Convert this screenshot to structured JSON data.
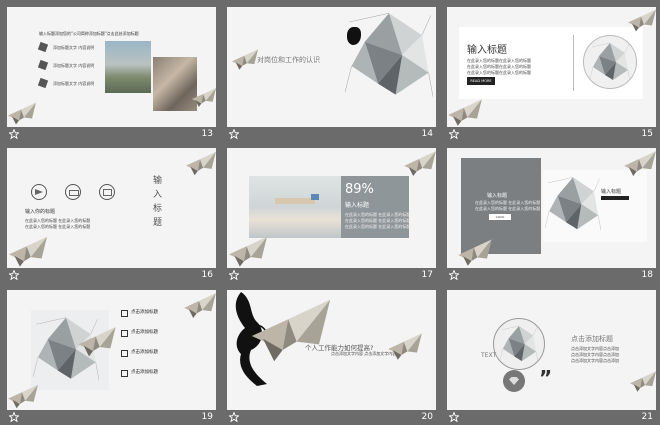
{
  "slides": [
    {
      "num": "13",
      "title": "输入标题添加您的\"公司简称添加标题\"点击此处添加标题",
      "items": [
        "添加标题文字 内容说明",
        "添加标题文字 内容说明",
        "添加标题文字 内容说明"
      ]
    },
    {
      "num": "14",
      "title": "对岗位和工作的认识"
    },
    {
      "num": "15",
      "title": "输入标题",
      "lines": [
        "在此录入您的标题在此录入您的标题",
        "在此录入您的标题在此录入您的标题",
        "在此录入您的标题在此录入您的标题"
      ],
      "button": "READ MORE"
    },
    {
      "num": "16",
      "title_vertical": "输入标题",
      "sub": "输入你的标题",
      "desc": [
        "在此录入您的标题 在此录入您的标题",
        "在此录入您的标题 在此录入您的标题"
      ]
    },
    {
      "num": "17",
      "big": "89%",
      "title": "输入标题",
      "desc": [
        "在此录入您的标题 在此录入您的标题",
        "在此录入您的标题 在此录入您的标题",
        "在此录入您的标题 在此录入您的标题"
      ]
    },
    {
      "num": "18",
      "title": "输入标题",
      "desc": [
        "在此录入您的标题 在此录入您的标题",
        "在此录入您的标题 在此录入您的标题"
      ],
      "button": "CLICK",
      "right_title": "输入标题"
    },
    {
      "num": "19",
      "items": [
        "点击添加标题",
        "点击添加标题",
        "点击添加标题",
        "点击添加标题"
      ]
    },
    {
      "num": "20",
      "title": "个人工作能力如何提高?",
      "sub": "点击添加文字内容 点击添加文字内容"
    },
    {
      "num": "21",
      "circle_text": "TEXT",
      "title": "点击添加标题",
      "quote": "”",
      "desc": [
        "点击添加文字内容点击添加",
        "点击添加文字内容点击添加",
        "点击添加文字内容点击添加"
      ]
    }
  ],
  "footer_icon": "star-icon"
}
